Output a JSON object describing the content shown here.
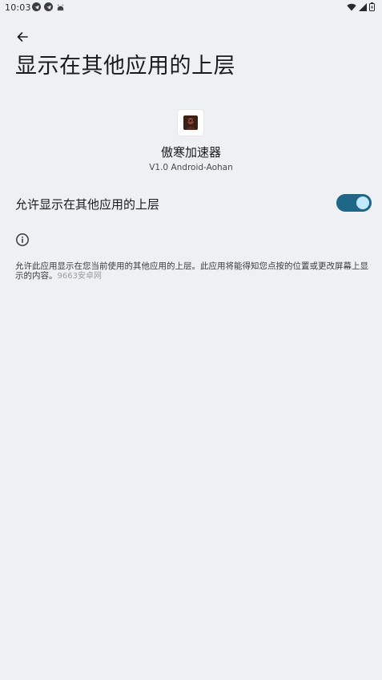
{
  "status_bar": {
    "time": "10:03",
    "left_icons": [
      "telegram-icon",
      "telegram-icon",
      "android-icon"
    ],
    "right_icons": [
      "wifi-icon",
      "cellular-signal-icon",
      "battery-icon"
    ]
  },
  "header": {
    "back_icon": "arrow-back-icon",
    "title": "显示在其他应用的上层"
  },
  "app": {
    "icon": "app-icon",
    "name": "傲寒加速器",
    "version": "V1.0 Android-Aohan"
  },
  "permission": {
    "label": "允许显示在其他应用的上层",
    "enabled": true
  },
  "info": {
    "icon": "info-icon",
    "description": "允许此应用显示在您当前使用的其他应用的上层。此应用将能得知您点按的位置或更改屏幕上显示的内容。",
    "watermark": "9663安卓网"
  },
  "colors": {
    "background": "#eff0f3",
    "toggle_track": "#1e6786",
    "toggle_thumb": "#c2e8ff"
  }
}
